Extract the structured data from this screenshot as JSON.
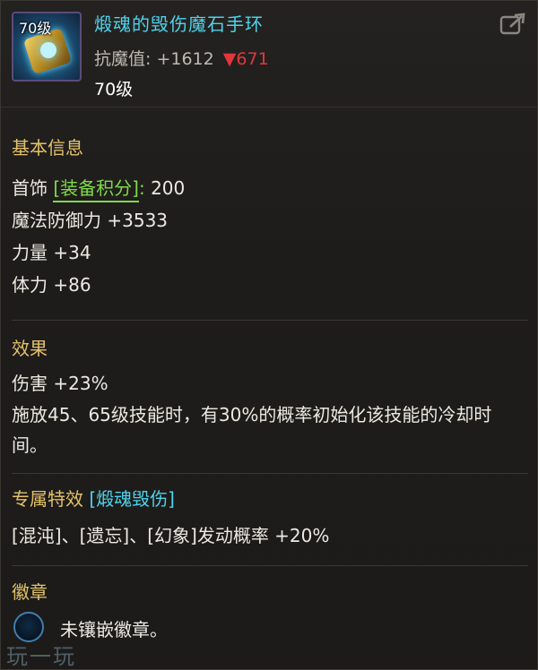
{
  "header": {
    "icon_level": "70级",
    "item_name": "煅魂的毁伤魔石手环",
    "stat_label": "抗魔值:",
    "stat_value": "+1612",
    "stat_down_arrow": "▼",
    "stat_down_value": "671",
    "required_level": "70级"
  },
  "basic_info": {
    "title": "基本信息",
    "score_prefix": "首饰",
    "score_tag": "[装备积分]",
    "score_sep": ":",
    "score_value": "200",
    "lines": [
      "魔法防御力 +3533",
      "力量 +34",
      "体力 +86"
    ]
  },
  "effect": {
    "title": "效果",
    "lines": [
      "伤害 +23%",
      "施放45、65级技能时，有30%的概率初始化该技能的冷却时间。"
    ]
  },
  "special": {
    "title": "专属特效",
    "tag": "[煅魂毁伤]",
    "line": "[混沌]、[遗忘]、[幻象]发动概率 +20%"
  },
  "badge": {
    "title": "徽章",
    "text": "未镶嵌徽章。"
  },
  "watermark": "玩一玩",
  "icons": {
    "share": "share-icon",
    "badge_slot": "badge-slot-icon"
  },
  "colors": {
    "item_name": "#4fd3ec",
    "section_title": "#e4c26a",
    "score_tag": "#7fd94a",
    "down_value": "#e2373a"
  }
}
